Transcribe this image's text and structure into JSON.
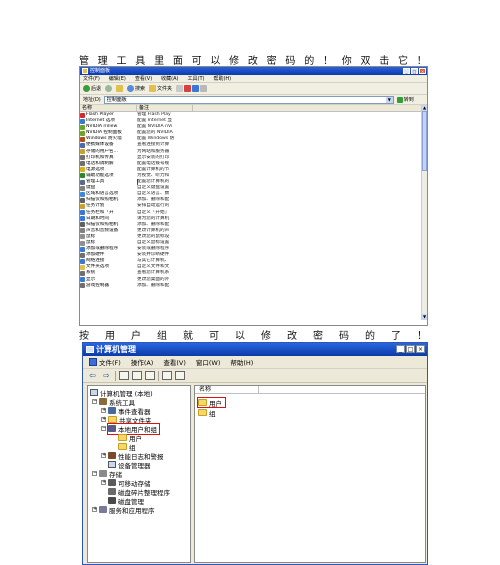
{
  "caption1": [
    "管",
    "理",
    "工",
    "具",
    "里",
    "面",
    "可",
    "以",
    "修",
    "改",
    "密",
    "码",
    "的",
    "！",
    "你",
    "双",
    "击",
    "它",
    "！"
  ],
  "caption2": [
    "按",
    "用",
    "户",
    "组",
    "就",
    "可",
    "以",
    "修",
    "改",
    "密",
    "码",
    "的",
    "了",
    "！"
  ],
  "control_panel": {
    "title": "控制面板",
    "window_buttons": [
      "_",
      "□",
      "×"
    ],
    "menu": [
      "文件(F)",
      "编辑(E)",
      "查看(V)",
      "收藏(A)",
      "工具(T)",
      "帮助(H)"
    ],
    "toolbar": {
      "back": "后退",
      "search": "搜索",
      "folders": "文件夹"
    },
    "address_label": "地址(D)",
    "address_value": "控制面板",
    "go_label": "转到",
    "columns": [
      "名称",
      "备注"
    ],
    "items": [
      {
        "name": "Flash Player",
        "comment": "管理 Flash Play",
        "color": "#d22a2a"
      },
      {
        "name": "Internet 选项",
        "comment": "配置 Internet 显",
        "color": "#3a78d8"
      },
      {
        "name": "NVIDIA nView",
        "comment": "配置 NVIDIA nVi",
        "color": "#6aa52a"
      },
      {
        "name": "NVIDIA 控制面板",
        "comment": "配置您的 NVIDIA",
        "color": "#6aa52a"
      },
      {
        "name": "Windows 防火墙",
        "comment": "配置 Windows 防",
        "color": "#b24a1a"
      },
      {
        "name": "便携媒体设备",
        "comment": "查看连接到计算",
        "color": "#4a6ab0"
      },
      {
        "name": "存储的用户名...",
        "comment": "为网站和服务器",
        "color": "#c8a030"
      },
      {
        "name": "打印机和传真",
        "comment": "显示安装的打印",
        "color": "#707070"
      },
      {
        "name": "电话和调制解",
        "comment": "配置电话拨号规",
        "color": "#707070"
      },
      {
        "name": "电源选项",
        "comment": "配置计算机的节",
        "color": "#d8b020"
      },
      {
        "name": "辅助功能选项",
        "comment": "为视觉、听力和",
        "color": "#2a8a2a"
      },
      {
        "name": "管理工具",
        "comment": "配置您计算机的",
        "color": "#5a6a8a"
      },
      {
        "name": "键盘",
        "comment": "自定义键盘设置",
        "color": "#808080"
      },
      {
        "name": "区域和语言选项",
        "comment": "自定义语言、数",
        "color": "#3a8ad8"
      },
      {
        "name": "扫描仪和照相机",
        "comment": "添加、删除和配",
        "color": "#606060"
      },
      {
        "name": "任务计划",
        "comment": "安排自动运行的",
        "color": "#c8a030"
      },
      {
        "name": "任务栏和「开",
        "comment": "自定义「开始」",
        "color": "#3a78d8"
      },
      {
        "name": "日期和时间",
        "comment": "请为您的计算机",
        "color": "#3a78d8"
      },
      {
        "name": "扫描仪和照相机",
        "comment": "添加、删除和配",
        "color": "#606060"
      },
      {
        "name": "声音和音频设备",
        "comment": "更改计算机的声",
        "color": "#808080"
      },
      {
        "name": "鼠标",
        "comment": "更改您的鼠标设",
        "color": "#909090"
      },
      {
        "name": "鼠标",
        "comment": "自定义鼠标设置",
        "color": "#909090"
      },
      {
        "name": "添加或删除程序",
        "comment": "安装或删除程序",
        "color": "#3a78d8"
      },
      {
        "name": "添加硬件",
        "comment": "安装并诊断硬件",
        "color": "#707070"
      },
      {
        "name": "网络连接",
        "comment": "与其它计算机、",
        "color": "#3a78d8"
      },
      {
        "name": "文件夹选项",
        "comment": "自定义文件和文",
        "color": "#e0c050"
      },
      {
        "name": "系统",
        "comment": "查看您计算机系",
        "color": "#707070"
      },
      {
        "name": "显示",
        "comment": "更改您桌面的外",
        "color": "#3a78d8"
      },
      {
        "name": "游戏控制器",
        "comment": "添加、删除和配",
        "color": "#707070"
      }
    ],
    "selected_index": 11
  },
  "computer_management": {
    "title": "计算机管理",
    "window_buttons": [
      "_",
      "□",
      "×"
    ],
    "menu": [
      "文件(F)",
      "操作(A)",
      "查看(V)",
      "窗口(W)",
      "帮助(H)"
    ],
    "toolbar": {
      "back_glyph": "⇦",
      "forward_glyph": "⇨"
    },
    "tree": [
      {
        "label": "计算机管理 (本地)",
        "icon": "computer-icon",
        "expander": ""
      },
      {
        "label": "系统工具",
        "icon": "tools-icon",
        "expander": "−"
      },
      {
        "label": "事件查看器",
        "icon": "event-icon",
        "expander": "+"
      },
      {
        "label": "共享文件夹",
        "icon": "share-icon",
        "expander": "+"
      },
      {
        "label": "本地用户和组",
        "icon": "users-icon",
        "expander": "−"
      },
      {
        "label": "用户",
        "icon": "folder-icon",
        "expander": ""
      },
      {
        "label": "组",
        "icon": "folder-icon",
        "expander": ""
      },
      {
        "label": "性能日志和警报",
        "icon": "perf-icon",
        "expander": "+"
      },
      {
        "label": "设备管理器",
        "icon": "device-icon",
        "expander": ""
      },
      {
        "label": "存储",
        "icon": "storage-icon",
        "expander": "−"
      },
      {
        "label": "可移动存储",
        "icon": "removable-icon",
        "expander": "+"
      },
      {
        "label": "磁盘碎片整理程序",
        "icon": "defrag-icon",
        "expander": ""
      },
      {
        "label": "磁盘管理",
        "icon": "disk-icon",
        "expander": ""
      },
      {
        "label": "服务和应用程序",
        "icon": "services-icon",
        "expander": "+"
      }
    ],
    "detail_header": "名称",
    "detail_items": [
      "用户",
      "组"
    ]
  }
}
